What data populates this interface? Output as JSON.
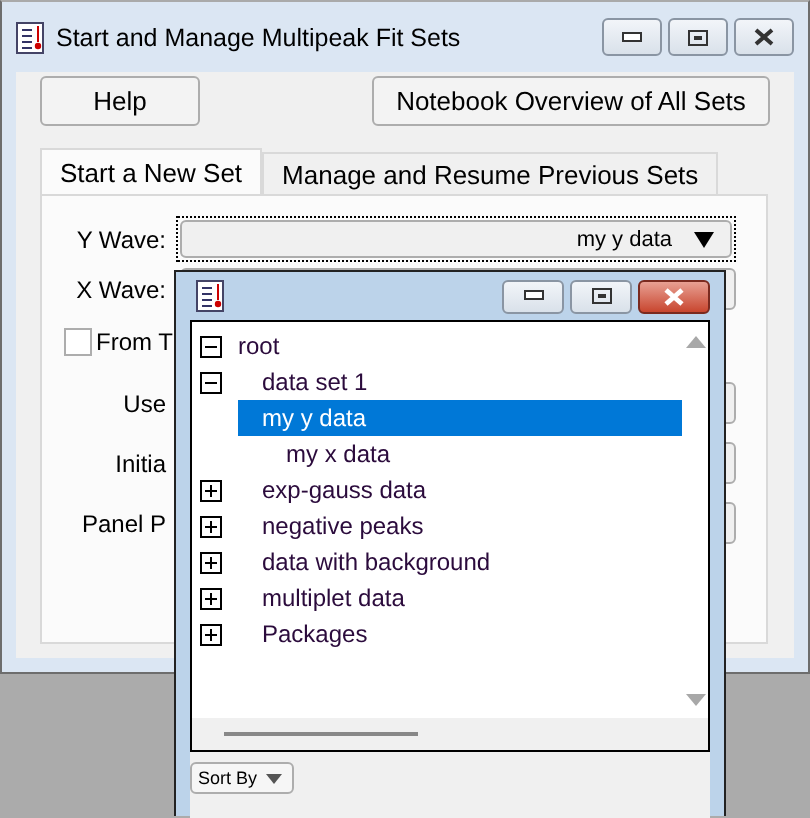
{
  "window": {
    "title": "Start and Manage Multipeak Fit Sets"
  },
  "buttons": [
    {
      "label": "Help"
    },
    {
      "label": "Notebook Overview of All Sets"
    }
  ],
  "tabs": [
    {
      "label": "Start a New Set",
      "selected": true
    },
    {
      "label": "Manage and Resume Previous Sets",
      "selected": false
    }
  ],
  "form": {
    "y_wave": {
      "label": "Y Wave:",
      "value": "my y data"
    },
    "x_wave": {
      "label": "X Wave:"
    },
    "checkbox": {
      "label": "From T",
      "checked": false
    },
    "rows": [
      {
        "label": "Use"
      },
      {
        "label": "Initia"
      },
      {
        "label": "Panel P"
      }
    ]
  },
  "browser": {
    "tree": [
      {
        "label": "root",
        "expanded": true,
        "selected": false,
        "children": [
          {
            "label": "data set 1",
            "expanded": true,
            "selected": false,
            "children": [
              {
                "label": "my y data",
                "selected": true
              },
              {
                "label": "my x data",
                "selected": false
              }
            ]
          },
          {
            "label": "exp-gauss data",
            "expanded": false,
            "selected": false
          },
          {
            "label": "negative peaks",
            "expanded": false,
            "selected": false
          },
          {
            "label": "data with background",
            "expanded": false,
            "selected": false
          },
          {
            "label": "multiplet data",
            "expanded": false,
            "selected": false
          },
          {
            "label": "Packages",
            "expanded": false,
            "selected": false
          }
        ]
      }
    ],
    "sort_button": {
      "label": "Sort By"
    }
  }
}
